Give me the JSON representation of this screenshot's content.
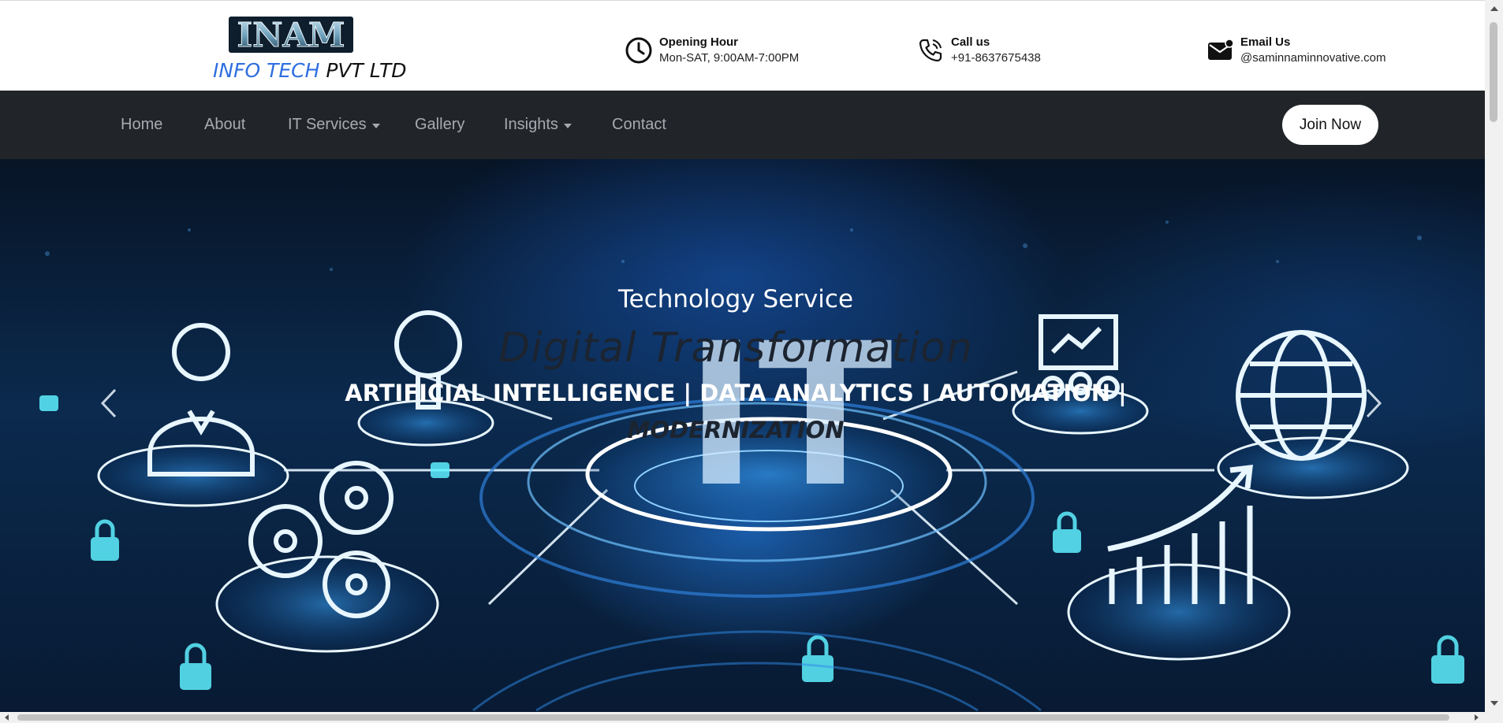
{
  "brand": {
    "logo_mark": "INAM",
    "name_part1": "INFO TECH",
    "name_part2": "PVT LTD",
    "colors": {
      "blue": "#2f6fe0",
      "black": "#111111"
    }
  },
  "contacts": [
    {
      "icon": "clock-icon",
      "label": "Opening Hour",
      "value": "Mon-SAT, 9:00AM-7:00PM"
    },
    {
      "icon": "phone-icon",
      "label": "Call us",
      "value": "+91-8637675438"
    },
    {
      "icon": "mail-icon",
      "label": "Email Us",
      "value": "@saminnaminnovative.com"
    }
  ],
  "nav": {
    "items": [
      {
        "label": "Home",
        "dropdown": false
      },
      {
        "label": "About",
        "dropdown": false
      },
      {
        "label": "IT Services",
        "dropdown": true
      },
      {
        "label": "Gallery",
        "dropdown": false
      },
      {
        "label": "Insights",
        "dropdown": true
      },
      {
        "label": "Contact",
        "dropdown": false
      }
    ],
    "cta_label": "Join Now",
    "background": "#212529"
  },
  "hero": {
    "subtitle": "Technology Service",
    "title": "Digital Transformation",
    "tagline_line1": "ARTIFICIAL INTELLIGENCE | DATA ANALYTICS I AUTOMATION |",
    "tagline_line2": "MODERNIZATION",
    "background_text": "IT",
    "prev_icon": "chevron-left-icon",
    "next_icon": "chevron-right-icon"
  }
}
